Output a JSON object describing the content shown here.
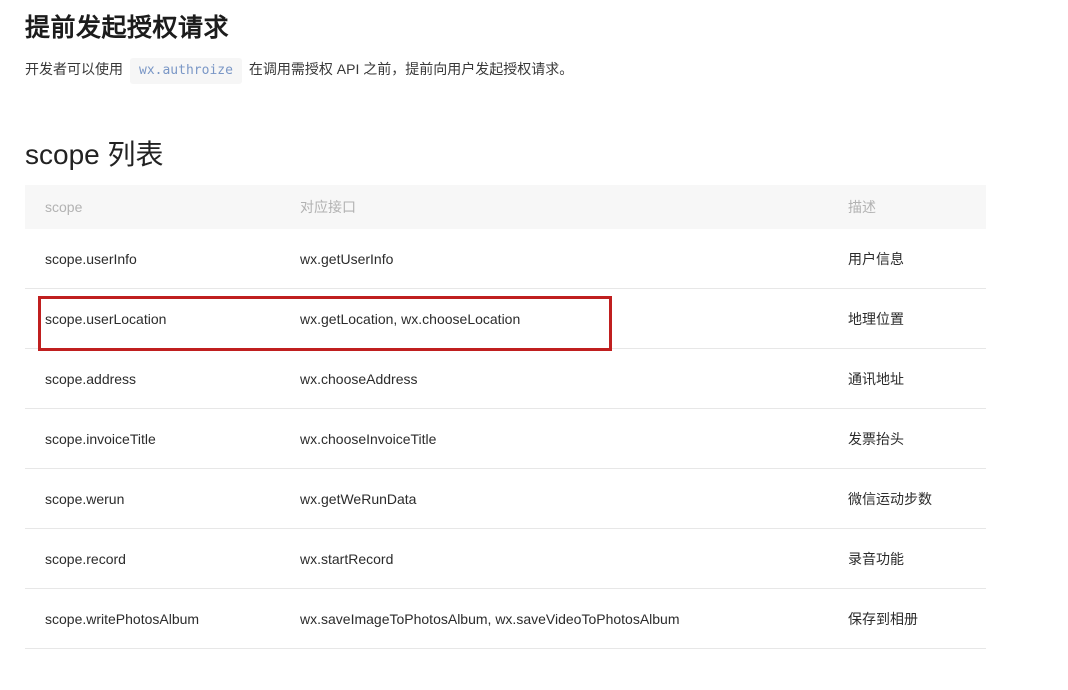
{
  "page": {
    "title": "提前发起授权请求",
    "intro": {
      "before_code": "开发者可以使用",
      "code": "wx.authroize",
      "after_code": "在调用需授权 API 之前，提前向用户发起授权请求。"
    },
    "section_heading": "scope 列表"
  },
  "table": {
    "columns": [
      "scope",
      "对应接口",
      "描述"
    ],
    "rows": [
      {
        "scope": "scope.userInfo",
        "api": "wx.getUserInfo",
        "desc": "用户信息"
      },
      {
        "scope": "scope.userLocation",
        "api": "wx.getLocation, wx.chooseLocation",
        "desc": "地理位置"
      },
      {
        "scope": "scope.address",
        "api": "wx.chooseAddress",
        "desc": "通讯地址"
      },
      {
        "scope": "scope.invoiceTitle",
        "api": "wx.chooseInvoiceTitle",
        "desc": "发票抬头"
      },
      {
        "scope": "scope.werun",
        "api": "wx.getWeRunData",
        "desc": "微信运动步数"
      },
      {
        "scope": "scope.record",
        "api": "wx.startRecord",
        "desc": "录音功能"
      },
      {
        "scope": "scope.writePhotosAlbum",
        "api": "wx.saveImageToPhotosAlbum, wx.saveVideoToPhotosAlbum",
        "desc": "保存到相册"
      }
    ]
  },
  "annotation": {
    "type": "red-highlight-box",
    "highlighted_row": "scope.userLocation",
    "color": "#c01f1f"
  },
  "colors": {
    "header_background": "#f7f7f7",
    "header_text": "#b2b2b2",
    "body_text": "#2b2b2b",
    "row_border": "#e7e7e7",
    "code_text": "#7a97c6",
    "code_background": "#f6f6f6",
    "annotation_red": "#c01f1f"
  }
}
